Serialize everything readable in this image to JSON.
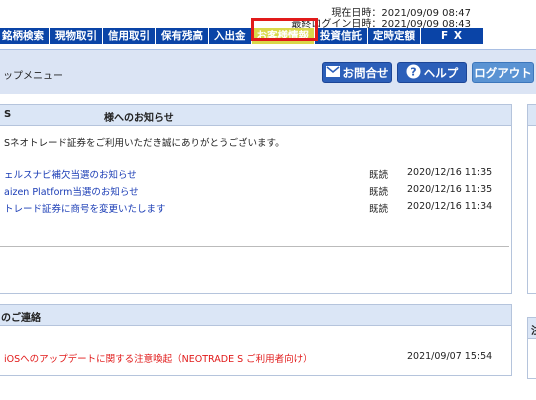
{
  "header": {
    "current_datetime_label": "現在日時：",
    "current_datetime": "2021/09/09 08:47",
    "last_login_label": "最終ログイン日時：",
    "last_login": "2021/09/09 08:43"
  },
  "nav": {
    "items": [
      "銘柄検索",
      "現物取引",
      "信用取引",
      "保有残高",
      "入出金",
      "お客様情報",
      "投資信託",
      "定時定額",
      "F X"
    ],
    "selected": "お客様情報"
  },
  "subbar": {
    "title": "ップメニュー",
    "contact": "お問合せ",
    "help": "ヘルプ",
    "logout": "ログアウト"
  },
  "notices": {
    "header_left": "S",
    "header_center": "様へのお知らせ",
    "greeting": "Sネオトレード証券をご利用いただき誠にありがとうございます。",
    "items": [
      {
        "title": "ェルスナビ補欠当選のお知らせ",
        "status": "既読",
        "date": "2020/12/16 11:35"
      },
      {
        "title": "aizen Platform当選のお知らせ",
        "status": "既読",
        "date": "2020/12/16 11:35"
      },
      {
        "title": "トレード証券に商号を変更いたします",
        "status": "既読",
        "date": "2020/12/16 11:34"
      }
    ]
  },
  "urgent": {
    "header": "のご連絡",
    "items": [
      {
        "title": "iOSへのアップデートに関する注意喚起（NEOTRADE S ご利用者向け）",
        "date": "2021/09/07 15:54"
      }
    ]
  },
  "right_panel_label": "注",
  "colors": {
    "nav_bg": "#0a44a7",
    "nav_selected": "#d9d84a",
    "highlight_border": "#e11a1a",
    "link": "#1a3cb5",
    "urgent": "#e11a1a"
  }
}
